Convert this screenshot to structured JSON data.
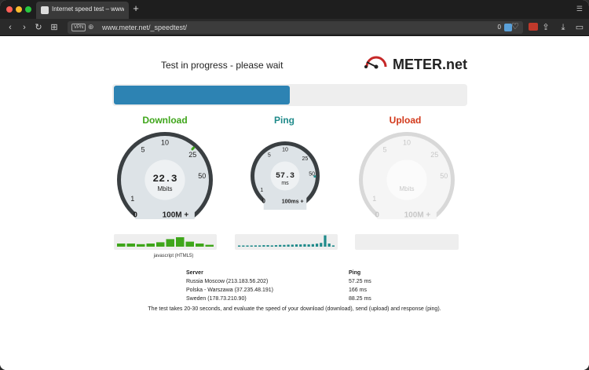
{
  "browser": {
    "tab_title": "Internet speed test – www.m",
    "new_tab_label": "+",
    "url": "www.meter.net/_speedtest/",
    "vpn_label": "VPN",
    "blocked_count": "0"
  },
  "page": {
    "status": "Test in progress - please wait",
    "logo_text": "METER.net",
    "progress": 0.5,
    "gauges": {
      "download": {
        "label": "Download",
        "color": "#3fa61b",
        "value": "22.3",
        "unit": "Mbits",
        "ticks": [
          "1",
          "5",
          "10",
          "25",
          "50"
        ],
        "min": "0",
        "max": "100M +",
        "level": 22.3
      },
      "ping": {
        "label": "Ping",
        "color": "#1f8a8a",
        "value": "57.3",
        "unit": "ms",
        "ticks": [
          "1",
          "5",
          "10",
          "25",
          "50"
        ],
        "min": "0",
        "max": "100ms +",
        "level": 57.3
      },
      "upload": {
        "label": "Upload",
        "color": "#d2381a",
        "value": "",
        "unit": "Mbits",
        "ticks": [
          "1",
          "5",
          "10",
          "25",
          "50"
        ],
        "min": "0",
        "max": "100M +"
      }
    },
    "download_history": [
      0.25,
      0.25,
      0.2,
      0.25,
      0.35,
      0.6,
      0.75,
      0.4,
      0.25,
      0.15
    ],
    "ping_history": [
      0.05,
      0.06,
      0.08,
      0.06,
      0.1,
      0.1,
      0.12,
      0.12,
      0.1,
      0.12,
      0.14,
      0.14,
      0.16,
      0.16,
      0.18,
      0.18,
      0.2,
      0.18,
      0.2,
      0.24,
      0.3,
      0.9,
      0.25,
      0.1
    ],
    "engine_label": "javascript (HTML5)",
    "servers_header": {
      "server": "Server",
      "ping": "Ping"
    },
    "servers": [
      {
        "name": "Russia Moscow (213.183.56.202)",
        "ping": "57.25 ms"
      },
      {
        "name": "Polska - Warszawa (37.235.48.191)",
        "ping": "166 ms"
      },
      {
        "name": "Sweden (178.73.210.90)",
        "ping": "88.25 ms"
      }
    ],
    "note": "The test takes 20-30 seconds, and evaluate the speed of your download (download), send (upload) and response (ping)."
  }
}
